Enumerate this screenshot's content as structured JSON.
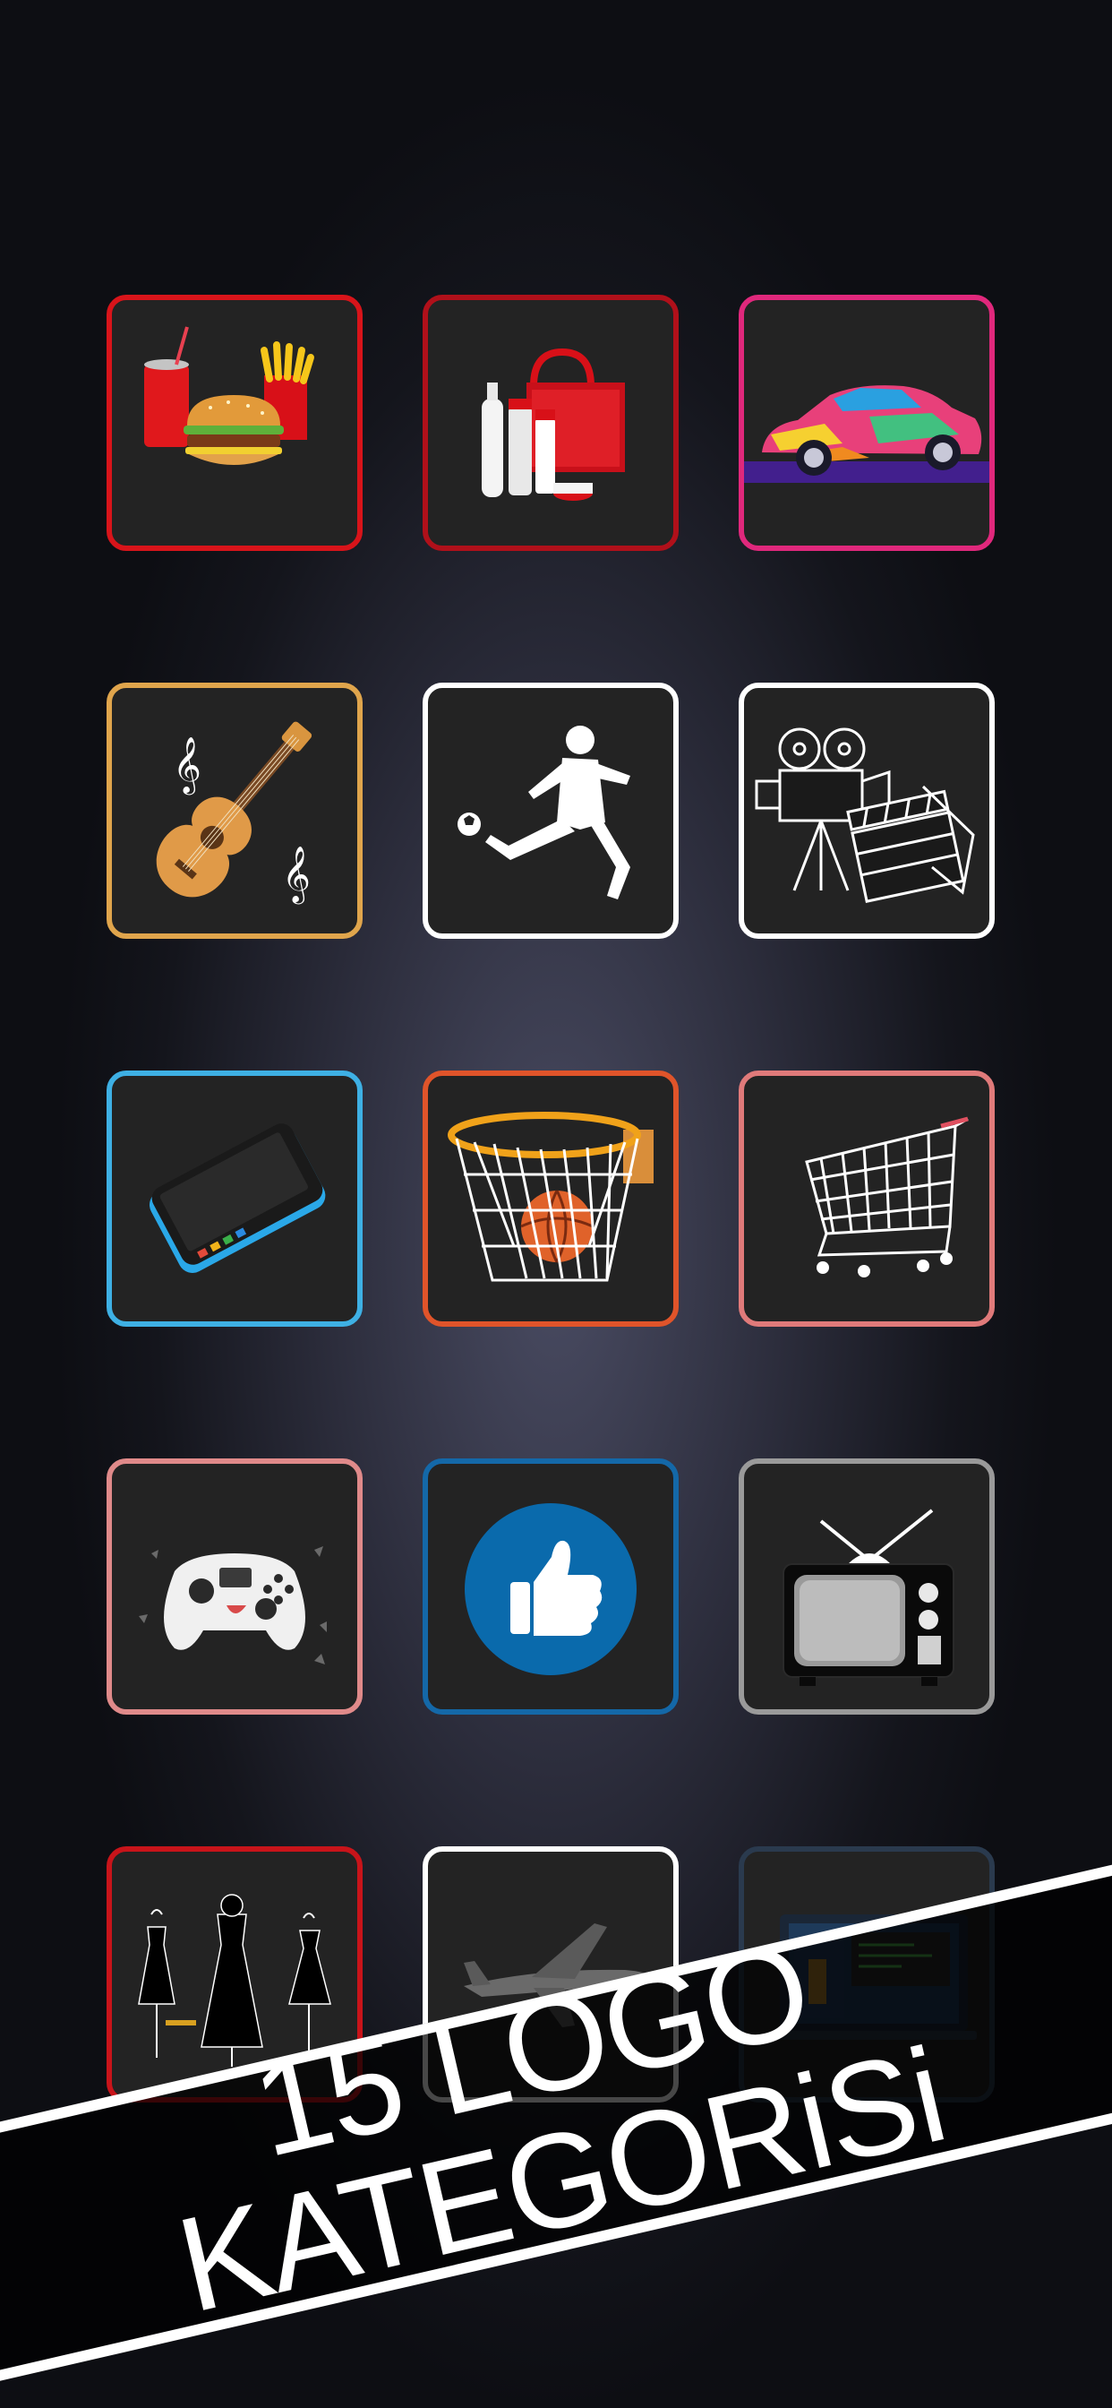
{
  "banner": {
    "line1": "15 LOGO",
    "line2": "KATEGORiSi"
  },
  "categories": [
    {
      "icon": "fast-food-icon",
      "border": "#d8141a"
    },
    {
      "icon": "cosmetics-icon",
      "border": "#b0101a"
    },
    {
      "icon": "car-icon",
      "border": "#e0287c"
    },
    {
      "icon": "guitar-icon",
      "border": "#e0a54c"
    },
    {
      "icon": "football-player-icon",
      "border": "#ffffff"
    },
    {
      "icon": "film-camera-icon",
      "border": "#ffffff"
    },
    {
      "icon": "smartphone-icon",
      "border": "#3eb0e4"
    },
    {
      "icon": "basketball-hoop-icon",
      "border": "#e0542a"
    },
    {
      "icon": "shopping-cart-icon",
      "border": "#e07a7a"
    },
    {
      "icon": "game-controller-icon",
      "border": "#e08a8a"
    },
    {
      "icon": "thumbs-up-icon",
      "border": "#1468a8"
    },
    {
      "icon": "television-icon",
      "border": "#9a9a9a"
    },
    {
      "icon": "fashion-dresses-icon",
      "border": "#c8141a"
    },
    {
      "icon": "airplane-icon",
      "border": "#ffffff"
    },
    {
      "icon": "laptop-code-icon",
      "border": "#2a3a4e"
    }
  ]
}
